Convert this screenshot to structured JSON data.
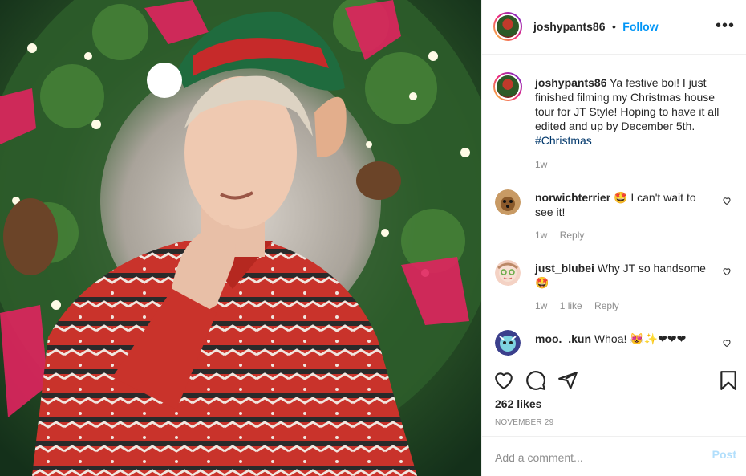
{
  "post": {
    "username": "joshypants86",
    "follow_label": "Follow",
    "separator": "•",
    "more": "•••",
    "photo_description_icon": "festive-photo"
  },
  "caption": {
    "username": "joshypants86",
    "text": "Ya festive boi! I just finished filming my Christmas house tour for JT Style! Hoping to have it all edited and up by December 5th.",
    "hashtag": "#Christmas",
    "time": "1w"
  },
  "comments": [
    {
      "username": "norwichterrier",
      "text": "🤩 I can't wait to see it!",
      "time": "1w",
      "likes": "",
      "reply": "Reply"
    },
    {
      "username": "just_blubei",
      "text": "Why JT so handsome 🤩",
      "time": "1w",
      "likes": "1 like",
      "reply": "Reply"
    },
    {
      "username": "moo._.kun",
      "text": "Whoa! 😻✨❤❤❤",
      "time": "",
      "likes": "",
      "reply": ""
    }
  ],
  "actions": {
    "likes": "262 likes",
    "date": "NOVEMBER 29"
  },
  "add_comment": {
    "placeholder": "Add a comment...",
    "post_label": "Post"
  },
  "colors": {
    "accent": "#0095f6",
    "post_disabled": "#b2dffc",
    "hashtag": "#00376b",
    "secondary_text": "#8e8e8e"
  }
}
